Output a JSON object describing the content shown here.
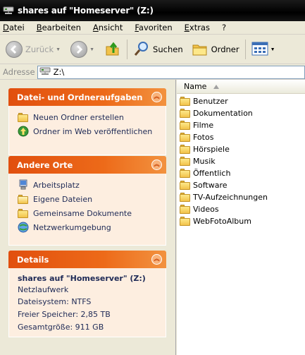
{
  "window": {
    "title": "shares auf \"Homeserver\" (Z:)"
  },
  "menu": [
    "Datei",
    "Bearbeiten",
    "Ansicht",
    "Favoriten",
    "Extras",
    "?"
  ],
  "toolbar": {
    "back_label": "Zurück",
    "search_label": "Suchen",
    "folders_label": "Ordner"
  },
  "address": {
    "label": "Adresse",
    "value": "Z:\\"
  },
  "tasks_panel": {
    "title": "Datei- und Ordneraufgaben",
    "items": [
      {
        "label": "Neuen Ordner erstellen",
        "icon": "new-folder-icon"
      },
      {
        "label": "Ordner im Web veröffentlichen",
        "icon": "publish-web-icon"
      }
    ]
  },
  "places_panel": {
    "title": "Andere Orte",
    "items": [
      {
        "label": "Arbeitsplatz",
        "icon": "my-computer-icon"
      },
      {
        "label": "Eigene Dateien",
        "icon": "my-documents-icon"
      },
      {
        "label": "Gemeinsame Dokumente",
        "icon": "shared-documents-icon"
      },
      {
        "label": "Netzwerkumgebung",
        "icon": "network-places-icon"
      }
    ]
  },
  "details_panel": {
    "title": "Details",
    "name": "shares auf \"Homeserver\" (Z:)",
    "type": "Netzlaufwerk",
    "filesystem": "Dateisystem: NTFS",
    "free": "Freier Speicher: 2,85 TB",
    "total": "Gesamtgröße: 911 GB"
  },
  "filelist": {
    "column_name": "Name",
    "folders": [
      "Benutzer",
      "Dokumentation",
      "Filme",
      "Fotos",
      "Hörspiele",
      "Musik",
      "Öffentlich",
      "Software",
      "TV-Aufzeichnungen",
      "Videos",
      "WebFotoAlbum"
    ]
  },
  "colors": {
    "panel_header": "#e14f0e",
    "panel_body": "#fdeee0",
    "titlebar": "#000000"
  }
}
